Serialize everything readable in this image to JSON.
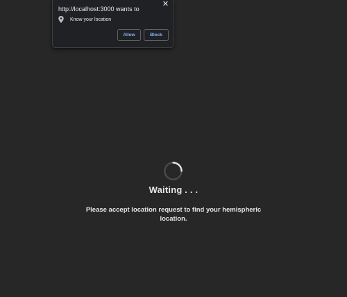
{
  "permission_popup": {
    "title": "http://localhost:3000 wants to",
    "permission_label": "Know your location",
    "permission_icon": "location-pin-icon",
    "close_icon": "close-icon",
    "allow_label": "Allow",
    "block_label": "Block"
  },
  "main": {
    "spinner_icon": "loading-spinner-icon",
    "status_title": "Waiting . . .",
    "message": "Please accept location request to find your hemispheric location."
  },
  "colors": {
    "background": "#272727",
    "popup_background": "#202124",
    "button_text": "#8ab4f8",
    "text": "#e6e6e6"
  }
}
